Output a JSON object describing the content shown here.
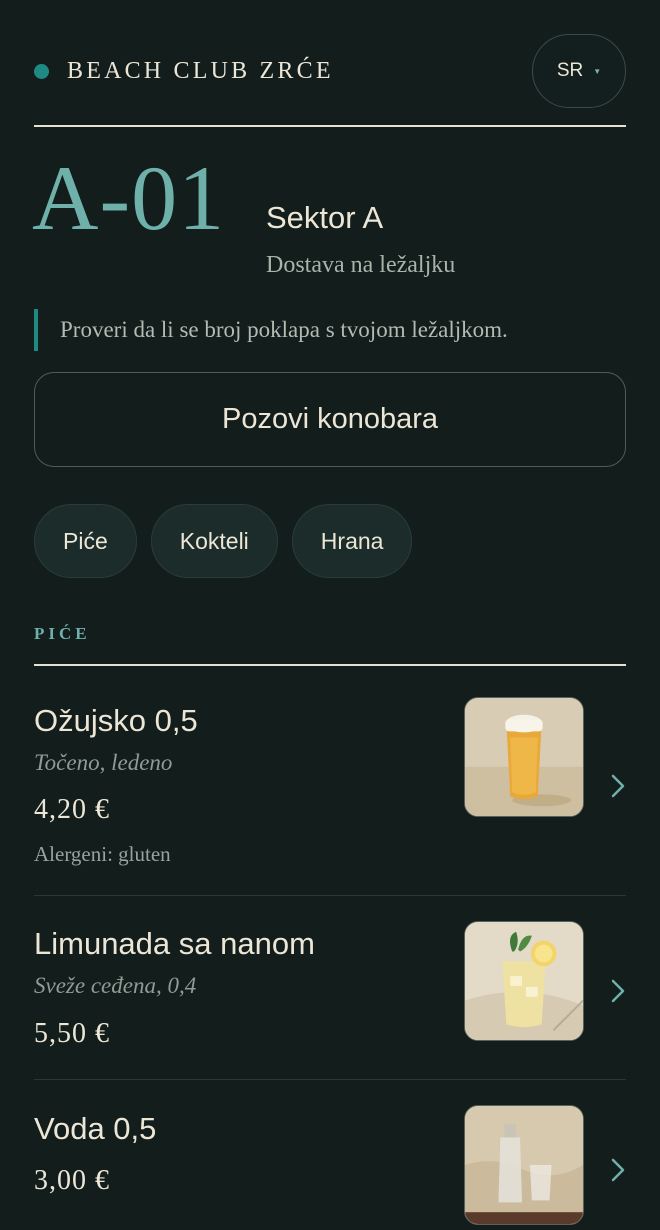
{
  "header": {
    "brand": "BEACH CLUB ZRĆE",
    "language": "SR"
  },
  "lounger": {
    "id": "A-01",
    "sector": "Sektor A",
    "delivery": "Dostava na ležaljku",
    "notice": "Proveri da li se broj poklapa s tvojom ležaljkom."
  },
  "actions": {
    "call_waiter": "Pozovi konobara"
  },
  "categories": [
    "Piće",
    "Kokteli",
    "Hrana"
  ],
  "section": {
    "title": "PIĆE"
  },
  "items": [
    {
      "name": "Ožujsko 0,5",
      "description": "Točeno, ledeno",
      "price": "4,20 €",
      "allergens": "Alergeni: gluten",
      "image": "beer-glass-photo"
    },
    {
      "name": "Limunada sa nanom",
      "description": "Sveže ceđena, 0,4",
      "price": "5,50 €",
      "image": "lemonade-mint-photo"
    },
    {
      "name": "Voda 0,5",
      "price": "3,00 €",
      "image": "water-bottle-photo"
    }
  ],
  "colors": {
    "background": "#121d1c",
    "accent": "#1f8a84",
    "accent_text": "#6fb0aa",
    "text": "#ece6d6"
  }
}
